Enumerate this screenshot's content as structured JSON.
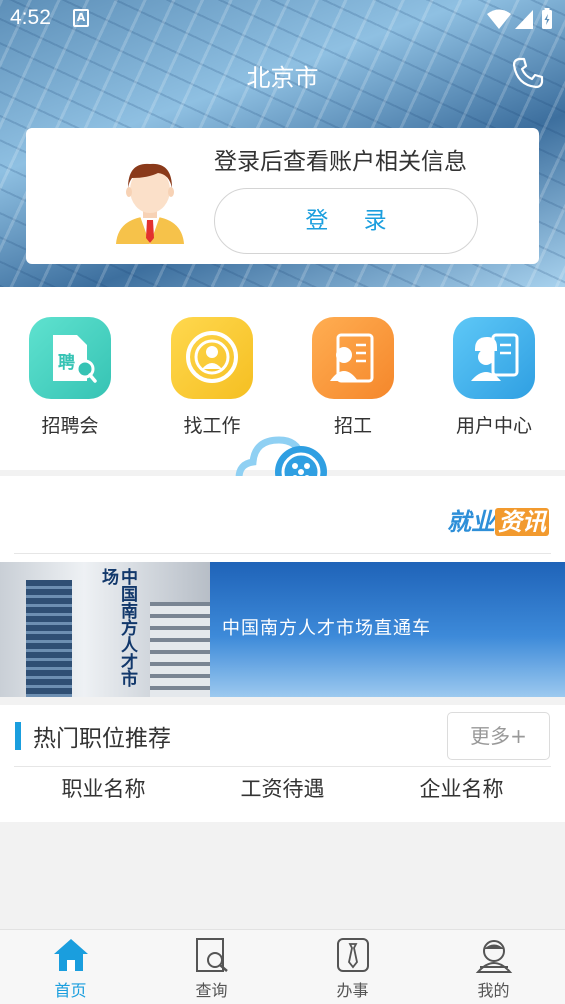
{
  "status_bar": {
    "time": "4:52",
    "notification_icon": "A"
  },
  "header": {
    "city": "北京市",
    "phone_icon": "phone-icon"
  },
  "login_card": {
    "prompt": "登录后查看账户相关信息",
    "login_label": "登 录"
  },
  "menu": {
    "items": [
      {
        "label": "招聘会",
        "icon": "job-fair-icon",
        "color": "#45d6c3"
      },
      {
        "label": "找工作",
        "icon": "find-job-icon",
        "color": "#f9cc36"
      },
      {
        "label": "招工",
        "icon": "recruit-icon",
        "color": "#f99a3c"
      },
      {
        "label": "用户中心",
        "icon": "user-center-icon",
        "color": "#3fb2ee"
      }
    ]
  },
  "news": {
    "tag_part1": "就业",
    "tag_part2": "资讯"
  },
  "banner": {
    "building_text": "中国南方人才市场",
    "slogan": "中国南方人才市场直通车"
  },
  "hot_jobs": {
    "title": "热门职位推荐",
    "more_label": "更多+",
    "columns": [
      "职业名称",
      "工资待遇",
      "企业名称"
    ]
  },
  "tabbar": {
    "tabs": [
      {
        "label": "首页",
        "icon": "home-icon",
        "active": true
      },
      {
        "label": "查询",
        "icon": "search-doc-icon",
        "active": false
      },
      {
        "label": "办事",
        "icon": "tie-icon",
        "active": false
      },
      {
        "label": "我的",
        "icon": "profile-icon",
        "active": false
      }
    ]
  },
  "colors": {
    "accent": "#1a9ede",
    "background": "#f2f2f2"
  }
}
